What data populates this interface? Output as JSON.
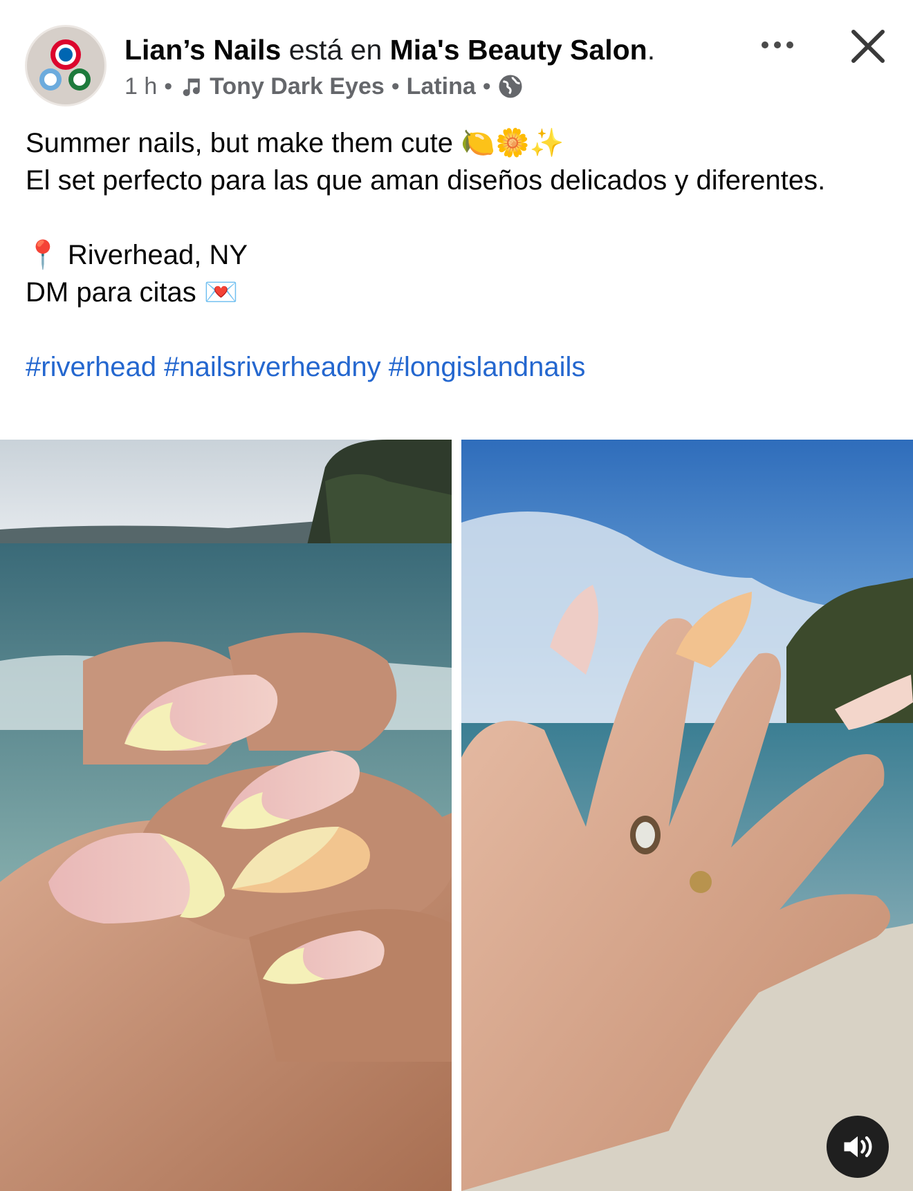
{
  "post": {
    "author": "Lian’s Nails",
    "connector": "está en",
    "place": "Mia's Beauty Salon",
    "place_suffix": ".",
    "time": "1 h",
    "sep1": "•",
    "music_artist": "Tony Dark Eyes",
    "sep2": "•",
    "music_genre": "Latina",
    "sep3": "•",
    "more_icon": "more-dots-icon",
    "close_icon": "close-icon"
  },
  "caption": {
    "line1": "Summer nails, but make them cute 🍋🌼✨",
    "line2": "El set perfecto para las que aman diseños delicados y diferentes.",
    "location": "📍 Riverhead, NY",
    "dm": "DM para citas 💌",
    "hashtags": [
      "#riverhead",
      "#nailsriverheadny",
      "#longislandnails"
    ]
  },
  "media": {
    "left_photo": "nails-photo-1",
    "right_photo": "nails-photo-2",
    "sound_icon": "speaker-icon"
  }
}
